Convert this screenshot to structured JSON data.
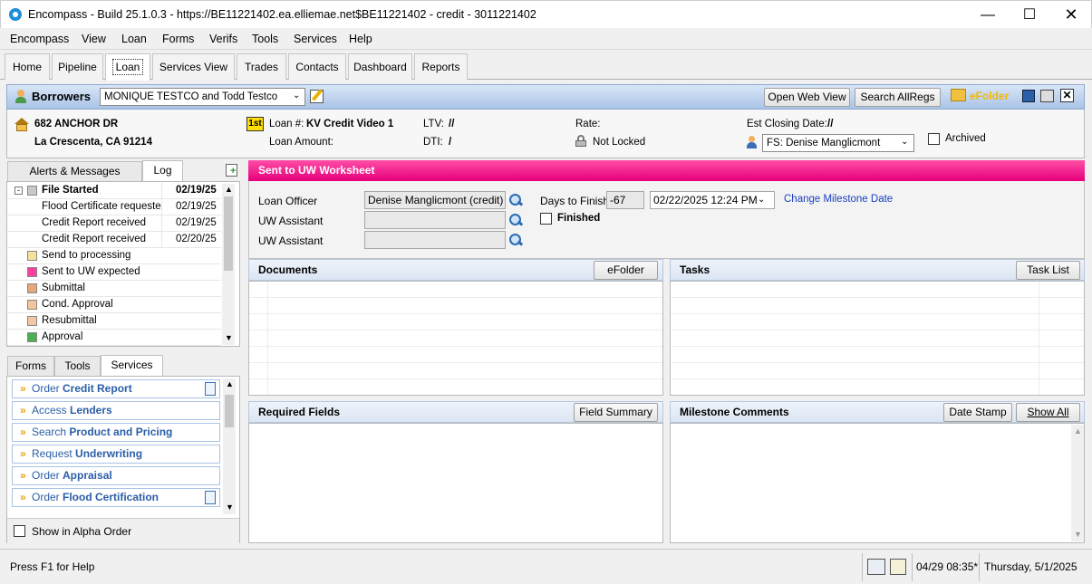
{
  "window": {
    "title": "Encompass - Build 25.1.0.3 - https://BE11221402.ea.elliemae.net$BE11221402 - credit - 3011221402"
  },
  "menu": [
    "Encompass",
    "View",
    "Loan",
    "Forms",
    "Verifs",
    "Tools",
    "Services",
    "Help"
  ],
  "tabs": [
    "Home",
    "Pipeline",
    "Loan",
    "Services View",
    "Trades",
    "Contacts",
    "Dashboard",
    "Reports"
  ],
  "active_tab": "Loan",
  "borrowers": {
    "label": "Borrowers",
    "selected": "MONIQUE TESTCO and Todd Testco",
    "open_web_view": "Open Web View",
    "search_allregs": "Search AllRegs",
    "efolder": "eFolder"
  },
  "info": {
    "address1": "682 ANCHOR DR",
    "address2": "La Crescenta, CA 91214",
    "lien": "1st",
    "loan_num_label": "Loan #:",
    "loan_num": "KV Credit Video 1",
    "loan_amount_label": "Loan Amount:",
    "ltv_label": "LTV:",
    "ltv": "//",
    "dti_label": "DTI:",
    "dti": "/",
    "rate_label": "Rate:",
    "lock_status": "Not Locked",
    "closing_label": "Est Closing Date:",
    "closing": "//",
    "fs_selected": "FS: Denise Manglicmont",
    "archived_label": "Archived"
  },
  "left_tabs": [
    "Alerts & Messages",
    "Log"
  ],
  "log_rows": [
    {
      "label": "File Started",
      "date": "02/19/25",
      "bold": true,
      "color": "#c8c8c8"
    },
    {
      "label": "Flood Certificate requested",
      "date": "02/19/25"
    },
    {
      "label": "Credit Report received",
      "date": "02/19/25"
    },
    {
      "label": "Credit Report received",
      "date": "02/20/25"
    },
    {
      "label": "Send to processing",
      "date": "",
      "color": "#f5e39a"
    },
    {
      "label": "Sent to UW expected",
      "date": "",
      "color": "#ff3fa0"
    },
    {
      "label": "Submittal",
      "date": "",
      "color": "#e6a77a"
    },
    {
      "label": "Cond. Approval",
      "date": "",
      "color": "#f2c59a"
    },
    {
      "label": "Resubmittal",
      "date": "",
      "color": "#f0c8a8"
    },
    {
      "label": "Approval",
      "date": "",
      "color": "#4caf50"
    }
  ],
  "bottom_tabs": [
    "Forms",
    "Tools",
    "Services"
  ],
  "services": [
    {
      "pre": "Order ",
      "bold": "Credit Report",
      "icon": "document-icon"
    },
    {
      "pre": "Access ",
      "bold": "Lenders",
      "icon": ""
    },
    {
      "pre": "Search ",
      "bold": "Product and Pricing",
      "icon": ""
    },
    {
      "pre": "Request ",
      "bold": "Underwriting",
      "icon": ""
    },
    {
      "pre": "Order ",
      "bold": "Appraisal",
      "icon": ""
    },
    {
      "pre": "Order ",
      "bold": "Flood Certification",
      "icon": "clock-document-icon"
    }
  ],
  "alpha_label": "Show in Alpha Order",
  "worksheet": {
    "title": "Sent to UW Worksheet",
    "loan_officer_label": "Loan Officer",
    "loan_officer": "Denise Manglicmont (credit)",
    "uw_assistant_label": "UW Assistant",
    "uw_assistant2_label": "UW Assistant",
    "days_label": "Days to Finish",
    "days": "-67",
    "finish_date": "02/22/2025 12:24 PM",
    "change_link": "Change Milestone Date",
    "finished_label": "Finished"
  },
  "sections": {
    "documents": "Documents",
    "efolder_btn": "eFolder",
    "tasks": "Tasks",
    "tasklist_btn": "Task List",
    "required": "Required Fields",
    "fieldsummary_btn": "Field Summary",
    "comments": "Milestone Comments",
    "datestamp_btn": "Date Stamp",
    "showall_btn": "Show All"
  },
  "status": {
    "help": "Press F1 for Help",
    "time": "04/29 08:35*",
    "date": "Thursday, 5/1/2025"
  }
}
